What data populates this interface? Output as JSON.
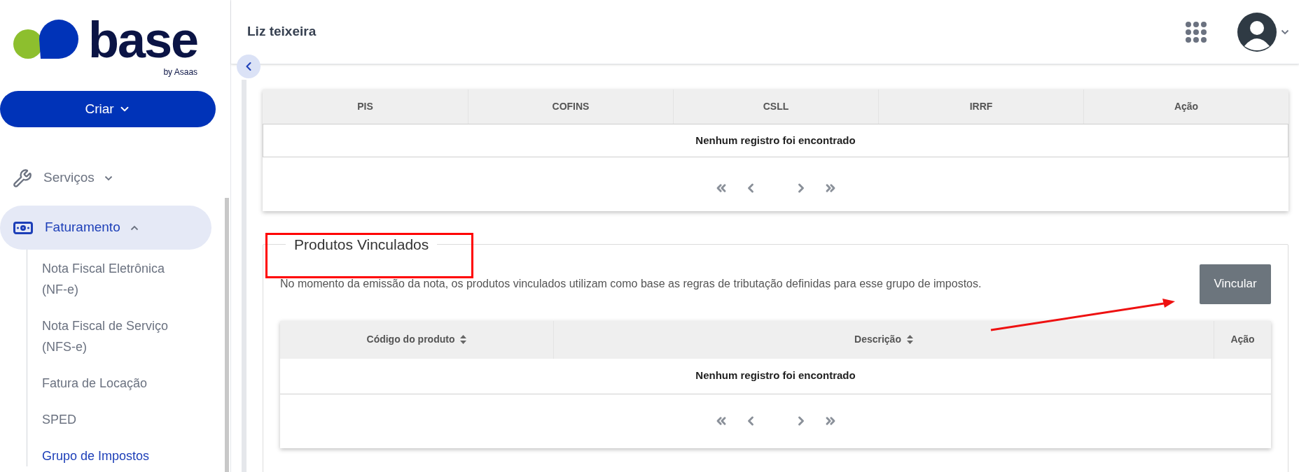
{
  "logo": {
    "name": "base",
    "tagline": "by Asaas"
  },
  "sidebar": {
    "create_button": "Criar",
    "items": [
      {
        "label": "Serviços",
        "kind": "wrench",
        "expanded": false,
        "selected": false
      },
      {
        "label": "Faturamento",
        "kind": "money",
        "expanded": true,
        "selected": true,
        "children": [
          {
            "label": "Nota Fiscal Eletrônica (NF-e)",
            "selected": false
          },
          {
            "label": "Nota Fiscal de Serviço (NFS-e)",
            "selected": false
          },
          {
            "label": "Fatura de Locação",
            "selected": false
          },
          {
            "label": "SPED",
            "selected": false
          },
          {
            "label": "Grupo de Impostos",
            "selected": true
          }
        ]
      }
    ]
  },
  "header": {
    "user_name": "Liz teixeira"
  },
  "taxes_table": {
    "columns": [
      "PIS",
      "COFINS",
      "CSLL",
      "IRRF",
      "Ação"
    ],
    "empty_message": "Nenhum registro foi encontrado"
  },
  "linked_products": {
    "title": "Produtos Vinculados",
    "description": "No momento da emissão da nota, os produtos vinculados utilizam como base as regras de tributação definidas para esse grupo de impostos.",
    "button": "Vincular",
    "table": {
      "columns": [
        {
          "label": "Código do produto",
          "sortable": true
        },
        {
          "label": "Descrição",
          "sortable": true
        },
        {
          "label": "Ação",
          "sortable": false
        }
      ],
      "empty_message": "Nenhum registro foi encontrado"
    }
  }
}
